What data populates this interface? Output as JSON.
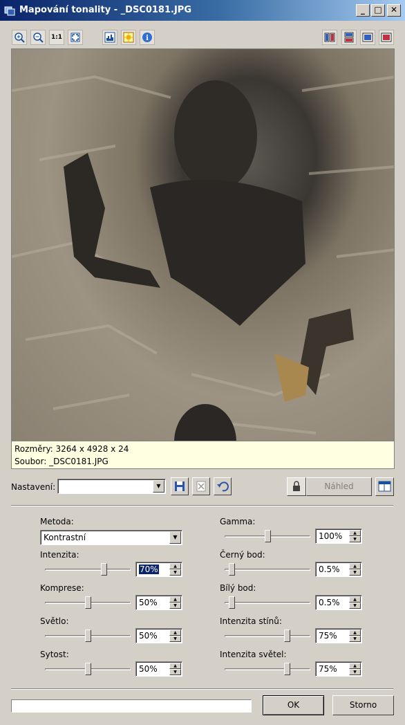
{
  "window": {
    "title": "Mapování tonality - _DSC0181.JPG",
    "minimize_glyph": "_",
    "maximize_glyph": "□",
    "close_glyph": "✕"
  },
  "toolbar": {
    "zoom_in_icon": "zoom-in-icon",
    "zoom_out_icon": "zoom-out-icon",
    "actual_size_label": "1:1",
    "fit_icon": "fit-to-window-icon",
    "histogram_icon": "histogram-icon",
    "exposure_icon": "exposure-warning-icon",
    "info_icon": "info-icon",
    "info_glyph": "i",
    "view_modes": [
      "split-vertical-icon",
      "split-horizontal-icon",
      "single-preview-icon",
      "original-icon"
    ]
  },
  "image_info": {
    "dimensions": "Rozměry: 3264 x 4928 x 24",
    "file": "Soubor: _DSC0181.JPG"
  },
  "settings": {
    "label": "Nastavení:",
    "value": "",
    "preview_button": "Náhled"
  },
  "left": {
    "method_label": "Metoda:",
    "method_value": "Kontrastní",
    "sliders": [
      {
        "label": "Intenzita:",
        "value": "70%",
        "level": 0.7,
        "selected": true
      },
      {
        "label": "Komprese:",
        "value": "50%",
        "level": 0.5
      },
      {
        "label": "Světlo:",
        "value": "50%",
        "level": 0.5
      },
      {
        "label": "Sytost:",
        "value": "50%",
        "level": 0.5
      }
    ]
  },
  "right": {
    "sliders": [
      {
        "label": "Gamma:",
        "value": "100%",
        "level": 0.5
      },
      {
        "label": "Černý bod:",
        "value": "0.5%",
        "level": 0.05
      },
      {
        "label": "Bílý bod:",
        "value": "0.5%",
        "level": 0.05
      },
      {
        "label": "Intenzita stínů:",
        "value": "75%",
        "level": 0.75
      },
      {
        "label": "Intenzita světel:",
        "value": "75%",
        "level": 0.75
      }
    ]
  },
  "footer": {
    "progress": 0,
    "ok_label": "OK",
    "cancel_label": "Storno"
  }
}
